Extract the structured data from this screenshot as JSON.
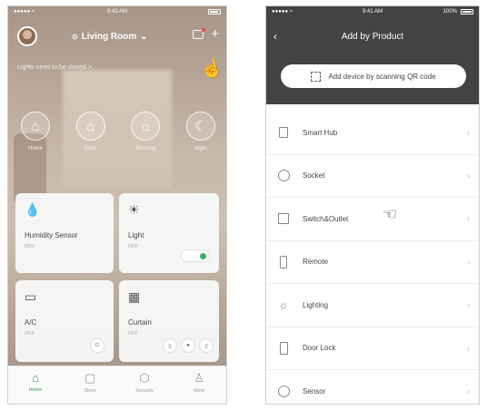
{
  "left_screen": {
    "status_bar": {
      "carrier": "●●●●● ≈",
      "time": "9:41 AM"
    },
    "header": {
      "room_name": "Living Room",
      "room_chevron": "⌄"
    },
    "notice": "Lights need to be closed >",
    "scenes": [
      {
        "icon": "home-icon",
        "label": "Home"
      },
      {
        "icon": "back-home-icon",
        "label": "Back"
      },
      {
        "icon": "morning-icon",
        "label": "Morning"
      },
      {
        "icon": "night-icon",
        "label": "Night"
      }
    ],
    "devices": {
      "humidity": {
        "name": "Humidity Sensor",
        "status": "60%"
      },
      "light": {
        "name": "Light",
        "status": "OFF",
        "toggle_on": true
      },
      "ac": {
        "name": "A/C",
        "status": "OFF"
      },
      "curtain": {
        "name": "Curtain",
        "status": "OFF"
      }
    },
    "tabs": [
      {
        "icon": "home-tab-icon",
        "label": "Home",
        "active": true
      },
      {
        "icon": "store-tab-icon",
        "label": "Store",
        "active": false
      },
      {
        "icon": "security-tab-icon",
        "label": "Security",
        "active": false
      },
      {
        "icon": "user-tab-icon",
        "label": "Mine",
        "active": false
      }
    ],
    "accent": "#2f9e55"
  },
  "right_screen": {
    "status_bar": {
      "carrier": "●●●●● ≈",
      "time": "9:41 AM",
      "battery": "100%"
    },
    "title": "Add by Product",
    "scan_button": "Add device by scanning QR code",
    "products": [
      {
        "label": "Smart Hub",
        "icon": "hub-icon"
      },
      {
        "label": "Socket",
        "icon": "socket-icon"
      },
      {
        "label": "Switch&Outlet",
        "icon": "switch-icon"
      },
      {
        "label": "Remote",
        "icon": "remote-icon"
      },
      {
        "label": "Lighting",
        "icon": "lighting-icon"
      },
      {
        "label": "Door Lock",
        "icon": "door-lock-icon"
      },
      {
        "label": "Sensor",
        "icon": "sensor-icon"
      }
    ],
    "header_color": "#434343"
  }
}
